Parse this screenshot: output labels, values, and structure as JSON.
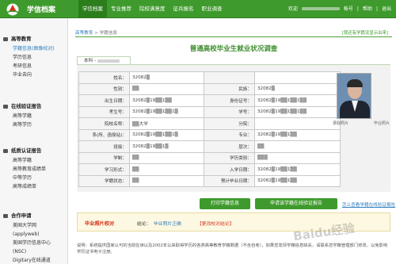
{
  "header": {
    "site_title": "学信档案",
    "nav": [
      "学信档案",
      "专业推荐",
      "院校满意度",
      "征兵报名",
      "职业调查"
    ],
    "user": {
      "welcome": "欢迎",
      "account": "帐号",
      "help": "帮助",
      "logout": "退出"
    }
  },
  "sidebar": {
    "sections": [
      {
        "title": "高等教育",
        "items": [
          "学籍信息(图像校对)",
          "学历信息",
          "考研信息",
          "毕业去向"
        ]
      },
      {
        "title": "在线验证报告",
        "items": [
          "高等学籍",
          "高等学历"
        ]
      },
      {
        "title": "纸质认证报告",
        "items": [
          "高等学籍",
          "高等教育成绩单",
          "中等学历",
          "高等成绩单"
        ]
      },
      {
        "title": "合作申请",
        "items": [
          "美国大学网",
          "(applyweb)",
          "美国学历信息中心",
          "(NSC)",
          "Digitary在线通道"
        ]
      }
    ]
  },
  "breadcrumb": {
    "home": "高等教育",
    "sep": ">",
    "current": "学籍信息"
  },
  "right_link": "[我还有学籍没显示出来]",
  "page_title": "普通高校毕业生就业状况调查",
  "tab_label": "本科 -",
  "record": {
    "rows": [
      {
        "l1": "姓名：",
        "v1": "32082▒",
        "l2": "",
        "v2": ""
      },
      {
        "l1": "性别：",
        "v1": "▒▒",
        "l2": "民族：",
        "v2": "32082▒"
      },
      {
        "l1": "出生日期：",
        "v1": "32082▒19▒▒1▒▒",
        "l2": "身份证号：",
        "v2": "32082▒19▒▒1▒▒1▒▒"
      },
      {
        "l1": "考生号：",
        "v1": "32082▒19▒▒1▒▒1▒",
        "l2": "学号：",
        "v2": "32082▒19▒▒1▒▒1▒▒"
      },
      {
        "l1": "院校名称：",
        "v1": "▒▒大学",
        "l2": "分院：",
        "v2": ""
      },
      {
        "l1": "系(所、函授站)：",
        "v1": "32082▒19▒▒1▒▒1▒",
        "l2": "专业：",
        "v2": "32082▒19▒▒1▒▒"
      },
      {
        "l1": "班级：",
        "v1": "32082▒19▒▒1▒",
        "l2": "层次：",
        "v2": "▒▒"
      },
      {
        "l1": "学制：",
        "v1": "▒▒",
        "l2": "学历类别：",
        "v2": "▒▒▒"
      },
      {
        "l1": "学习形式：",
        "v1": "▒▒",
        "l2": "入学日期：",
        "v2": "32082▒19▒▒1▒▒"
      },
      {
        "l1": "学籍状态：",
        "v1": "▒▒",
        "l2": "预计毕业日期：",
        "v2": "32082▒19▒▒1▒▒"
      }
    ]
  },
  "photo": {
    "left_caption": "录取照片",
    "right_caption": "毕业照片"
  },
  "buttons": {
    "print": "打印学籍信息",
    "apply": "申请该学籍在线验证报告",
    "howto": "怎么查看学籍在线验证报告"
  },
  "verify": {
    "title": "毕业照片校对",
    "status_label": "结论：",
    "status_value": "毕业照片正确",
    "change": "【更改校对结论】"
  },
  "note": "说明：系统提供国家认可的当前在读以及2002年以来取得学历的各类高等教育学籍数据（不含自考），如果您发现学籍信息缺失，请联系您学籍管理部门修改，以免影响学历证书电子注册。",
  "watermark": "Baidu经验",
  "colors": {
    "brand_green": "#3e9a2c",
    "link_blue": "#2e7fc0",
    "alert_red": "#d8321c"
  }
}
